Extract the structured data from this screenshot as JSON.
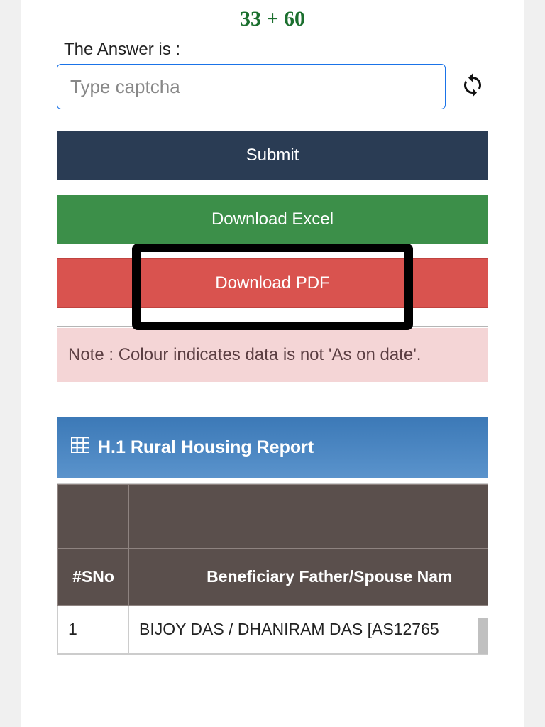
{
  "captcha": {
    "question": "33 + 60",
    "label": "The Answer is :",
    "placeholder": "Type captcha"
  },
  "buttons": {
    "submit": "Submit",
    "excel": "Download Excel",
    "pdf": "Download PDF"
  },
  "note": "Note : Colour indicates data is not 'As on date'.",
  "report": {
    "title": "H.1 Rural Housing Report",
    "columns": {
      "sno": "#SNo",
      "beneficiary": "Beneficiary Father/Spouse Nam"
    },
    "rows": [
      {
        "sno": "1",
        "beneficiary": "BIJOY DAS / DHANIRAM DAS [AS12765"
      }
    ]
  }
}
